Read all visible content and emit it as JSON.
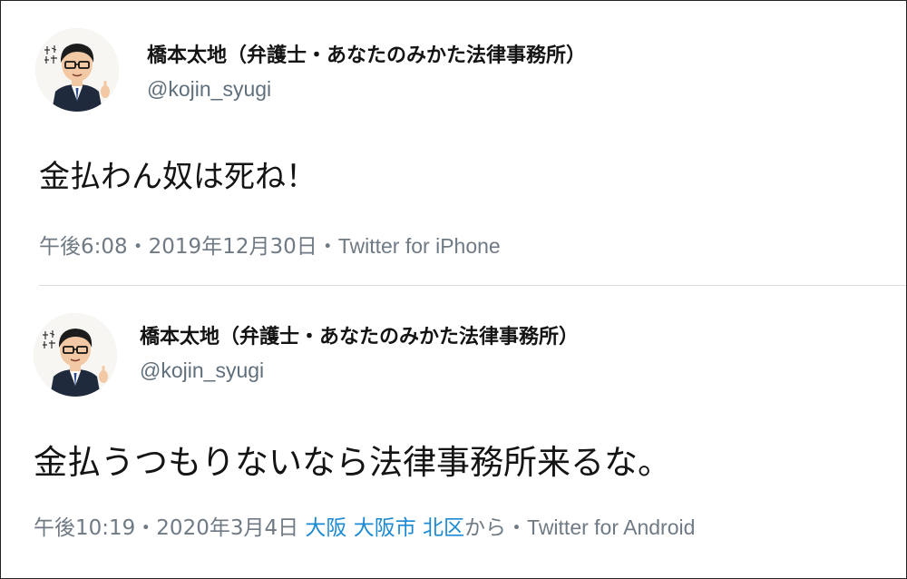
{
  "tweets": [
    {
      "display_name": "橋本太地（弁護士・あなたのみかた法律事務所）",
      "handle": "@kojin_syugi",
      "text": "金払わん奴は死ね！",
      "time": "午後6:08",
      "separator": "・",
      "date": "2019年12月30日",
      "source": "Twitter for iPhone",
      "avatar_icon": "lawyer-avatar-icon"
    },
    {
      "display_name": "橋本太地（弁護士・あなたのみかた法律事務所）",
      "handle": "@kojin_syugi",
      "text": "金払うつもりないなら法律事務所来るな。",
      "time": "午後10:19",
      "separator": "・",
      "date": "2020年3月4日",
      "location": [
        "大阪",
        "大阪市",
        "北区"
      ],
      "location_suffix": "から",
      "source": "Twitter for Android",
      "avatar_icon": "lawyer-avatar-icon"
    }
  ],
  "colors": {
    "text": "#141414",
    "secondary": "#6f7a84",
    "handle": "#5f6f7c",
    "link": "#1b8ad3",
    "divider": "#dadde0"
  }
}
